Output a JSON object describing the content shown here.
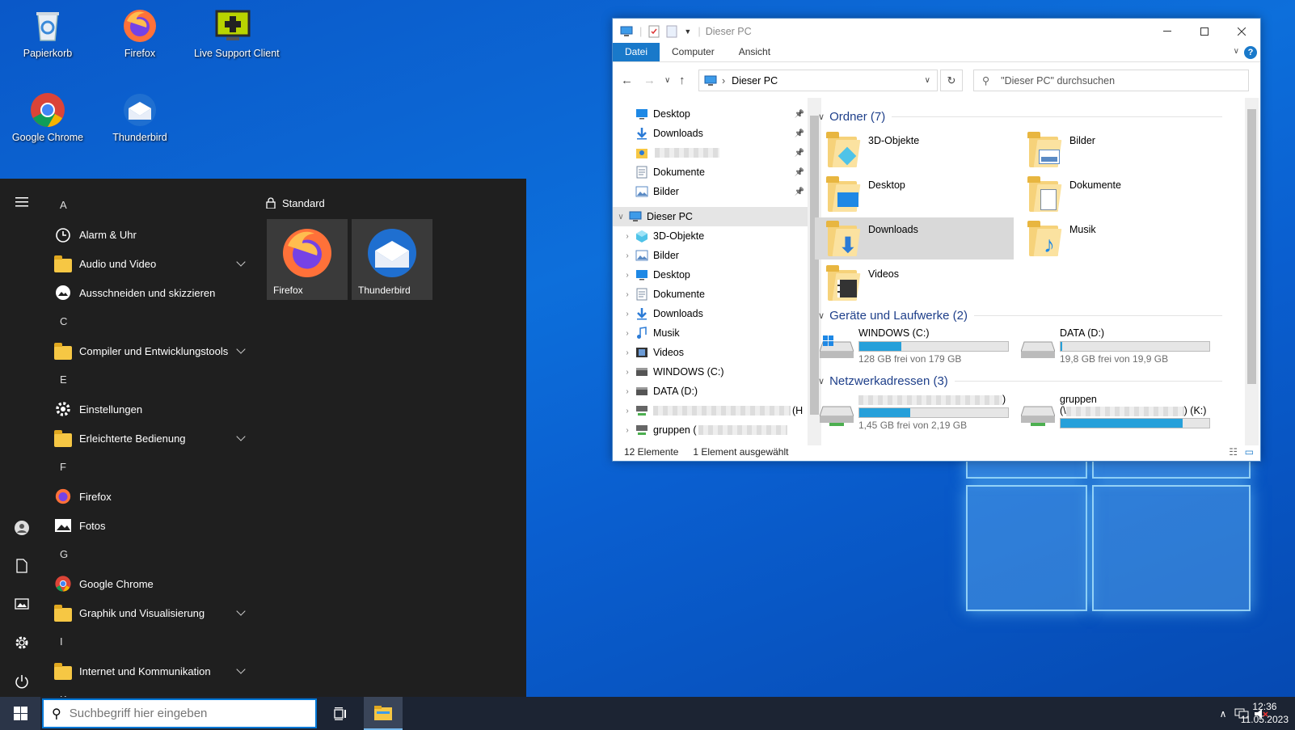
{
  "desktop": {
    "icons": [
      {
        "label": "Papierkorb",
        "icon": "recycle-bin-icon"
      },
      {
        "label": "Firefox",
        "icon": "firefox-icon"
      },
      {
        "label": "Live Support Client",
        "icon": "live-support-icon"
      },
      {
        "label": "Google Chrome",
        "icon": "chrome-icon"
      },
      {
        "label": "Thunderbird",
        "icon": "thunderbird-icon"
      }
    ]
  },
  "start_menu": {
    "apps": [
      {
        "type": "letter",
        "label": "A"
      },
      {
        "type": "app",
        "label": "Alarm & Uhr",
        "icon": "alarm-clock-icon"
      },
      {
        "type": "folder",
        "label": "Audio und Video"
      },
      {
        "type": "app",
        "label": "Ausschneiden und skizzieren",
        "icon": "snip-sketch-icon"
      },
      {
        "type": "letter",
        "label": "C"
      },
      {
        "type": "folder",
        "label": "Compiler und Entwicklungstools"
      },
      {
        "type": "letter",
        "label": "E"
      },
      {
        "type": "app",
        "label": "Einstellungen",
        "icon": "gear-icon"
      },
      {
        "type": "folder",
        "label": "Erleichterte Bedienung"
      },
      {
        "type": "letter",
        "label": "F"
      },
      {
        "type": "app",
        "label": "Firefox",
        "icon": "firefox-icon"
      },
      {
        "type": "app",
        "label": "Fotos",
        "icon": "photos-icon"
      },
      {
        "type": "letter",
        "label": "G"
      },
      {
        "type": "app",
        "label": "Google Chrome",
        "icon": "chrome-icon"
      },
      {
        "type": "folder",
        "label": "Graphik und Visualisierung"
      },
      {
        "type": "letter",
        "label": "I"
      },
      {
        "type": "folder",
        "label": "Internet und Kommunikation"
      },
      {
        "type": "letter",
        "label": "K"
      }
    ],
    "tiles_header": "Standard",
    "tiles": [
      {
        "label": "Firefox",
        "icon": "firefox-icon"
      },
      {
        "label": "Thunderbird",
        "icon": "thunderbird-icon"
      }
    ]
  },
  "taskbar": {
    "search_placeholder": "Suchbegriff hier eingeben",
    "time": "12:36",
    "date": "11.05.2023"
  },
  "explorer": {
    "title": "Dieser PC",
    "ribbon_tabs": [
      "Datei",
      "Computer",
      "Ansicht"
    ],
    "address": "Dieser PC",
    "search_placeholder": "\"Dieser PC\" durchsuchen",
    "quick_access": [
      {
        "label": "Desktop",
        "icon": "desktop-icon"
      },
      {
        "label": "Downloads",
        "icon": "download-arrow-icon"
      },
      {
        "label": "",
        "icon": "user-folder-icon"
      },
      {
        "label": "Dokumente",
        "icon": "document-icon"
      },
      {
        "label": "Bilder",
        "icon": "pictures-icon"
      }
    ],
    "this_pc_label": "Dieser PC",
    "this_pc_children": [
      {
        "label": "3D-Objekte",
        "icon": "3d-objects-icon"
      },
      {
        "label": "Bilder",
        "icon": "pictures-icon"
      },
      {
        "label": "Desktop",
        "icon": "desktop-icon"
      },
      {
        "label": "Dokumente",
        "icon": "document-icon"
      },
      {
        "label": "Downloads",
        "icon": "download-arrow-icon"
      },
      {
        "label": "Musik",
        "icon": "music-icon"
      },
      {
        "label": "Videos",
        "icon": "videos-icon"
      },
      {
        "label": "WINDOWS (C:)",
        "icon": "drive-icon"
      },
      {
        "label": "DATA (D:)",
        "icon": "drive-icon"
      },
      {
        "label": "(H",
        "icon": "network-drive-icon"
      },
      {
        "label": "gruppen (",
        "icon": "network-drive-icon"
      }
    ],
    "folders_group": "Ordner (7)",
    "folders": [
      {
        "label": "3D-Objekte",
        "icon": "3d-objects-icon"
      },
      {
        "label": "Bilder",
        "icon": "pictures-icon"
      },
      {
        "label": "Desktop",
        "icon": "desktop-icon"
      },
      {
        "label": "Dokumente",
        "icon": "document-icon"
      },
      {
        "label": "Downloads",
        "icon": "download-arrow-icon"
      },
      {
        "label": "Musik",
        "icon": "music-icon"
      },
      {
        "label": "Videos",
        "icon": "videos-icon"
      }
    ],
    "drives_group": "Geräte und Laufwerke (2)",
    "drives": [
      {
        "label": "WINDOWS (C:)",
        "free": "128 GB frei von 179 GB",
        "used_fraction": 0.28
      },
      {
        "label": "DATA (D:)",
        "free": "19,8 GB frei von 19,9 GB",
        "used_fraction": 0.01
      }
    ],
    "network_group": "Netzwerkadressen (3)",
    "network": [
      {
        "label": ")",
        "free": "1,45 GB frei von 2,19 GB",
        "used_fraction": 0.34
      },
      {
        "label": "gruppen",
        "label2_prefix": "(\\",
        "label2_suffix": ") (K:)",
        "free": "",
        "used_fraction": 0.82
      }
    ],
    "status_count": "12 Elemente",
    "status_selected": "1 Element ausgewählt"
  }
}
